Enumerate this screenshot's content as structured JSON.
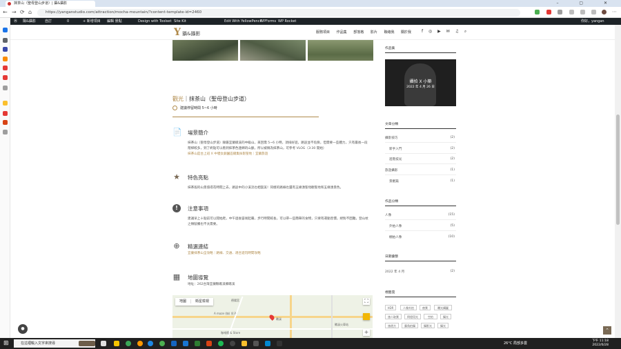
{
  "browser": {
    "tab_title": "抹茶山（聖母登山步道）| 攝&攝影",
    "url": "https://yanganstudio.com/attraction/mocha-mountain/?content-template-id=2460",
    "back": "←",
    "forward": "→",
    "reload": "⟳",
    "home": "⌂",
    "window_controls": "– ▢ ✕"
  },
  "wp_admin_bar": {
    "site": "陽&攝影",
    "customize": "自訂",
    "comments": "0",
    "new": "+ 新增項目",
    "edit": "編輯 景點",
    "toolset": "Design with Toolset",
    "sitekit": "Site Kit",
    "yellowpencil": "Edit With YellowPencil",
    "wpforms": "WPForms",
    "wprocket": "WP Rocket",
    "greeting": "你好，yangan"
  },
  "site": {
    "logo_mark": "Y",
    "logo_text": "攝&攝影",
    "nav": [
      "服務項目",
      "作品集",
      "部落格",
      "影片",
      "聯絡我",
      "關於我"
    ],
    "socials": "f ◎ ▶ ✉ ♫ ⌕"
  },
  "article": {
    "category": "觀光",
    "sep": "｜",
    "title": "抹茶山（聖母登山步道）",
    "time_note": "建議停留時間 5~6 小時",
    "sections": [
      {
        "title": "場景簡介",
        "icon": "📄",
        "body": "抹茶山（聖母登山步道）隸屬宜蘭礁溪的中級山，來回需 5~6 小時，須排好遊，路途並不危險，但需要一些體力，只有最後一段階梯較多，到了終點可以看到抹茶色連綿的山脈，所以被稱為抹茶山，可參考 VLOG（3:30 開始）",
        "link": "抹茶山是台上班 X 中壢女劇園區總集採影聖地｜宜蘭旅遊"
      },
      {
        "title": "特色亮點",
        "icon": "★",
        "body": "抹茶般的山景值得花時間上去，路途中的小溪流也相當美！同樣的路線也還有五緣湧聖母觀聖地和五緣湧景色。",
        "link": ""
      },
      {
        "title": "注意事項",
        "icon": "!",
        "body": "建議早上十點前可以開始爬，中午過後容易起霧，步行時間較長，可以帶一些簡單的食物，只要有運動習慣，絕對不困難，登山杖之類裝備也不太需要。",
        "link": ""
      },
      {
        "title": "精選連結",
        "icon": "⊕",
        "body": "",
        "link": "宜蘭抹茶山全攻略｜路線、交通、適合遊玩時間攻略"
      },
      {
        "title": "地圖導覽",
        "icon": "▦",
        "body": "地址：262台灣宜蘭縣礁溪鄉礁溪",
        "link": ""
      }
    ]
  },
  "map": {
    "tab_map": "地圖",
    "tab_satellite": "衛星檢視",
    "labels": [
      "礁溪",
      "A maze (絲) 兒子",
      "咖啡館 & Store",
      "德陽宮",
      "礁溪火車站"
    ],
    "zoom_in": "+",
    "fullscreen": "⛶"
  },
  "sidebar": {
    "works_title": "作品集",
    "featured_title": "攝拍 X 小築",
    "featured_date": "2022 年 4 月 26 日",
    "categories_title": "文章分類",
    "categories": [
      {
        "label": "攝影技巧",
        "count": "(2)",
        "sub": false
      },
      {
        "label": "新手入門",
        "count": "(2)",
        "sub": true
      },
      {
        "label": "進階技光",
        "count": "(2)",
        "sub": true
      },
      {
        "label": "旅遊攝影",
        "count": "(1)",
        "sub": false
      },
      {
        "label": "景觀篇",
        "count": "(1)",
        "sub": true
      }
    ],
    "works_cat_title": "作品分類",
    "works_cats": [
      {
        "label": "人像",
        "count": "(15)",
        "sub": false
      },
      {
        "label": "外拍人像",
        "count": "(5)",
        "sub": true
      },
      {
        "label": "棚拍人像",
        "count": "(10)",
        "sub": true
      }
    ],
    "archive_title": "日期彙整",
    "archive": [
      {
        "label": "2022 年 4 月",
        "count": "(2)"
      }
    ],
    "tags_title": "標籤雲",
    "tags": [
      "HDR",
      "人像外拍",
      "夜景",
      "曝光構圖",
      "旅人取景",
      "閃燈用光",
      "空拍",
      "攝光",
      "旅遊方",
      "廣角拍攝",
      "攝影光",
      "攝光"
    ]
  },
  "taskbar": {
    "search_placeholder": "在這裡輸入文字來搜尋",
    "weather": "26°C 局部多雲",
    "time": "下午 11:18",
    "date": "2022/6/28"
  },
  "colors": {
    "accent": "#b08a4a",
    "wp_bar": "#1d2327",
    "taskbar": "#202020"
  }
}
